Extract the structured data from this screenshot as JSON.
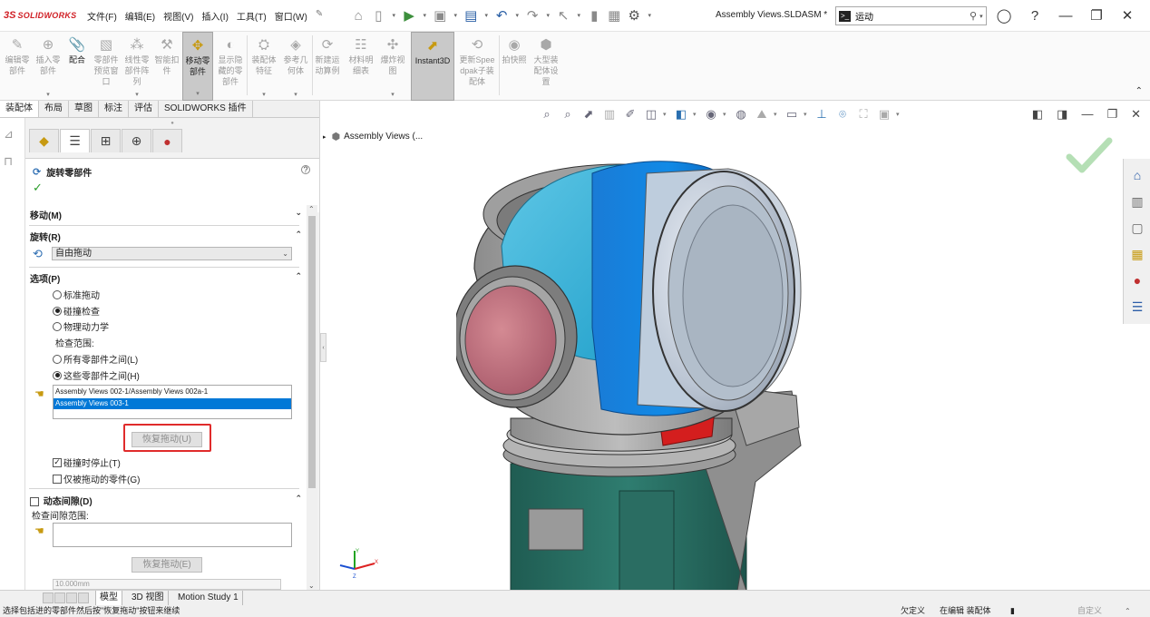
{
  "app": {
    "logo_mark": "3S",
    "logo_text": "SOLIDWORKS",
    "document_title": "Assembly Views.SLDASM *",
    "menu": [
      "文件(F)",
      "编辑(E)",
      "视图(V)",
      "插入(I)",
      "工具(T)",
      "窗口(W)"
    ],
    "search": {
      "value": "运动",
      "placeholder": ""
    }
  },
  "ribbon": {
    "buttons": [
      {
        "label": "编辑零部件",
        "icon": "edit-component-icon"
      },
      {
        "label": "插入零部件",
        "icon": "insert-component-icon"
      },
      {
        "label": "配合",
        "icon": "mate-icon"
      },
      {
        "label": "零部件预览窗口",
        "icon": "component-preview-icon"
      },
      {
        "label": "线性零部件阵列",
        "icon": "linear-pattern-icon"
      },
      {
        "label": "智能扣件",
        "icon": "smart-fastener-icon"
      },
      {
        "label": "移动零部件",
        "icon": "move-component-icon"
      },
      {
        "label": "显示隐藏的零部件",
        "icon": "show-hidden-icon"
      },
      {
        "label": "装配体特征",
        "icon": "assembly-feature-icon"
      },
      {
        "label": "参考几何体",
        "icon": "reference-geometry-icon"
      },
      {
        "label": "新建运动算例",
        "icon": "motion-study-icon"
      },
      {
        "label": "材料明细表",
        "icon": "bom-icon"
      },
      {
        "label": "爆炸视图",
        "icon": "exploded-view-icon"
      },
      {
        "label": "Instant3D",
        "icon": "instant3d-icon"
      },
      {
        "label": "更新Speedpak子装配体",
        "icon": "speedpak-icon"
      },
      {
        "label": "拍快照",
        "icon": "snapshot-icon"
      },
      {
        "label": "大型装配体设置",
        "icon": "large-assembly-icon"
      }
    ]
  },
  "tabs": [
    "装配体",
    "布局",
    "草图",
    "标注",
    "评估",
    "SOLIDWORKS 插件"
  ],
  "property_manager": {
    "title": "旋转零部件",
    "sections": {
      "move": "移动(M)",
      "rotate": "旋转(R)",
      "options": "选项(P)",
      "dynamic_clearance": "动态间隙(D)"
    },
    "rotate_mode": "自由拖动",
    "options": {
      "standard_drag": "标准拖动",
      "collision_detection": "碰撞检查",
      "physical_dynamics": "物理动力学",
      "check_range_label": "检查范围:",
      "all_components": "所有零部件之间(L)",
      "these_components": "这些零部件之间(H)",
      "selected_option": "collision_detection",
      "selected_range": "these_components"
    },
    "component_list": [
      "Assembly Views 002-1/Assembly Views 002a-1",
      "Assembly Views 003-1"
    ],
    "resume_drag_button": "恢复拖动(U)",
    "stop_at_collision": "碰撞时停止(T)",
    "stop_at_collision_checked": true,
    "dragged_parts_only": "仅被拖动的零件(G)",
    "dragged_parts_only_checked": false,
    "dynamic_clearance_checked": false,
    "clearance_range_label": "检查间隙范围:",
    "resume_drag_button_2": "恢复拖动(E)",
    "distance_value": "10.000mm"
  },
  "viewport": {
    "tree_root": "Assembly Views (..."
  },
  "bottom_tabs": [
    "模型",
    "3D 视图",
    "Motion Study 1"
  ],
  "status": {
    "message": "选择包括进的零部件然后按\"恢复拖动\"按钮来继续",
    "definition": "欠定义",
    "editing": "在编辑 装配体",
    "custom": "自定义"
  },
  "colors": {
    "brand": "#d01f25",
    "selection": "#0078d7",
    "highlight_box": "#e02b2b",
    "confirm_check": "#5bb85b"
  }
}
